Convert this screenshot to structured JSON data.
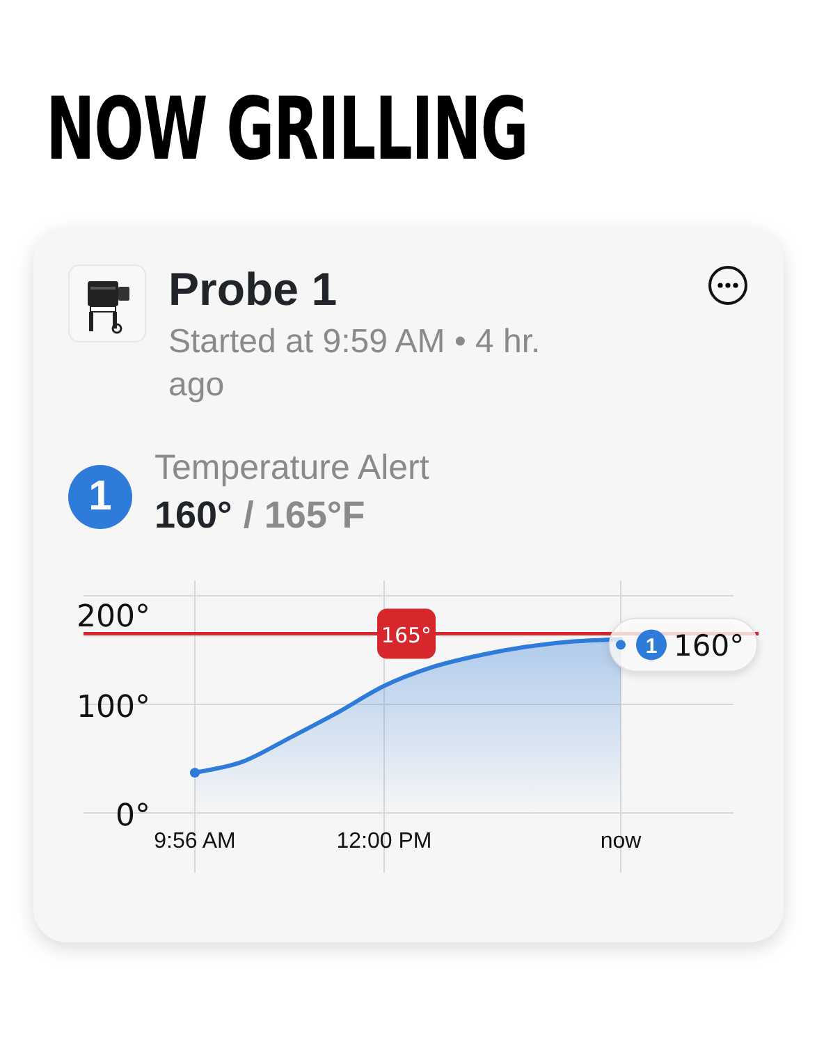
{
  "heading": "NOW GRILLING",
  "card": {
    "title": "Probe 1",
    "subtitle": "Started at 9:59 AM • 4 hr. ago",
    "alert": {
      "badge": "1",
      "label": "Temperature Alert",
      "current": "160°",
      "target": "/ 165°F"
    },
    "chart_data": {
      "type": "area",
      "categories": [
        "9:56 AM",
        null,
        null,
        null,
        "12:00 PM",
        null,
        null,
        null,
        null,
        "now",
        null,
        null
      ],
      "series": [
        {
          "name": "1",
          "color": "#2f7bd9",
          "values": [
            37,
            47,
            69,
            92,
            117,
            134,
            145,
            153,
            158,
            160,
            null,
            null
          ]
        }
      ],
      "ylim": [
        0,
        200
      ],
      "grid": true,
      "yticks": [
        {
          "value": 0,
          "label": "0°"
        },
        {
          "value": 100,
          "label": "100°"
        },
        {
          "value": 200,
          "label": "200°"
        }
      ],
      "ref_lines": [
        {
          "axis": "y",
          "value": 165,
          "label": "165°",
          "color": "#d7262c"
        }
      ],
      "annotations": [
        {
          "x": "now",
          "y": 160,
          "text": "160°"
        }
      ]
    }
  }
}
